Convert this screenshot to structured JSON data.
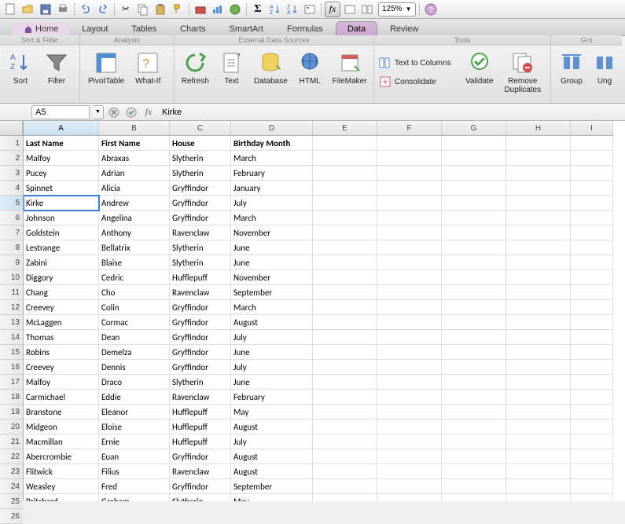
{
  "toolbar": {
    "zoom": "125%"
  },
  "tabs": [
    "Home",
    "Layout",
    "Tables",
    "Charts",
    "SmartArt",
    "Formulas",
    "Data",
    "Review"
  ],
  "active_tab": "Data",
  "ribbon": {
    "groups": [
      {
        "title": "Sort & Filter",
        "buttons": [
          {
            "label": "Sort"
          },
          {
            "label": "Filter"
          }
        ]
      },
      {
        "title": "Analysis",
        "buttons": [
          {
            "label": "PivotTable"
          },
          {
            "label": "What-If"
          }
        ]
      },
      {
        "title": "External Data Sources",
        "buttons": [
          {
            "label": "Refresh"
          },
          {
            "label": "Text"
          },
          {
            "label": "Database"
          },
          {
            "label": "HTML"
          },
          {
            "label": "FileMaker"
          }
        ]
      },
      {
        "title": "Tools",
        "rows": [
          {
            "label": "Text to Columns"
          },
          {
            "label": "Consolidate"
          }
        ],
        "buttons": [
          {
            "label": "Validate"
          },
          {
            "label": "Remove\nDuplicates"
          }
        ]
      },
      {
        "title": "Gro",
        "buttons": [
          {
            "label": "Group"
          },
          {
            "label": "Ung"
          }
        ]
      }
    ]
  },
  "formula_bar": {
    "name_box": "A5",
    "formula": "Kirke"
  },
  "columns": [
    "A",
    "B",
    "C",
    "D",
    "E",
    "F",
    "G",
    "H",
    "I"
  ],
  "selected_cell": {
    "row": 5,
    "col": 0
  },
  "headers": [
    "Last Name",
    "First Name",
    "House",
    "Birthday Month"
  ],
  "rows": [
    [
      "Malfoy",
      "Abraxas",
      "Slytherin",
      "March"
    ],
    [
      "Pucey",
      "Adrian",
      "Slytherin",
      "February"
    ],
    [
      "Spinnet",
      "Alicia",
      "Gryffindor",
      "January"
    ],
    [
      "Kirke",
      "Andrew",
      "Gryffindor",
      "July"
    ],
    [
      "Johnson",
      "Angelina",
      "Gryffindor",
      "March"
    ],
    [
      "Goldstein",
      "Anthony",
      "Ravenclaw",
      "November"
    ],
    [
      "Lestrange",
      "Bellatrix",
      "Slytherin",
      "June"
    ],
    [
      "Zabini",
      "Blaise",
      "Slytherin",
      "June"
    ],
    [
      "Diggory",
      "Cedric",
      "Hufflepuff",
      "November"
    ],
    [
      "Chang",
      "Cho",
      "Ravenclaw",
      "September"
    ],
    [
      "Creevey",
      "Colin",
      "Gryffindor",
      "March"
    ],
    [
      "McLaggen",
      "Cormac",
      "Gryffindor",
      "August"
    ],
    [
      "Thomas",
      "Dean",
      "Gryffindor",
      "July"
    ],
    [
      "Robins",
      "Demelza",
      "Gryffindor",
      "June"
    ],
    [
      "Creevey",
      "Dennis",
      "Gryffindor",
      "July"
    ],
    [
      "Malfoy",
      "Draco",
      "Slytherin",
      "June"
    ],
    [
      "Carmichael",
      "Eddie",
      "Ravenclaw",
      "February"
    ],
    [
      "Branstone",
      "Eleanor",
      "Hufflepuff",
      "May"
    ],
    [
      "Midgeon",
      "Eloise",
      "Hufflepuff",
      "August"
    ],
    [
      "Macmillan",
      "Ernie",
      "Hufflepuff",
      "July"
    ],
    [
      "Abercrombie",
      "Euan",
      "Gryffindor",
      "August"
    ],
    [
      "Flitwick",
      "Filius",
      "Ravenclaw",
      "August"
    ],
    [
      "Weasley",
      "Fred",
      "Gryffindor",
      "September"
    ],
    [
      "Pritchard",
      "Graham",
      "Slytherin",
      "May"
    ]
  ]
}
